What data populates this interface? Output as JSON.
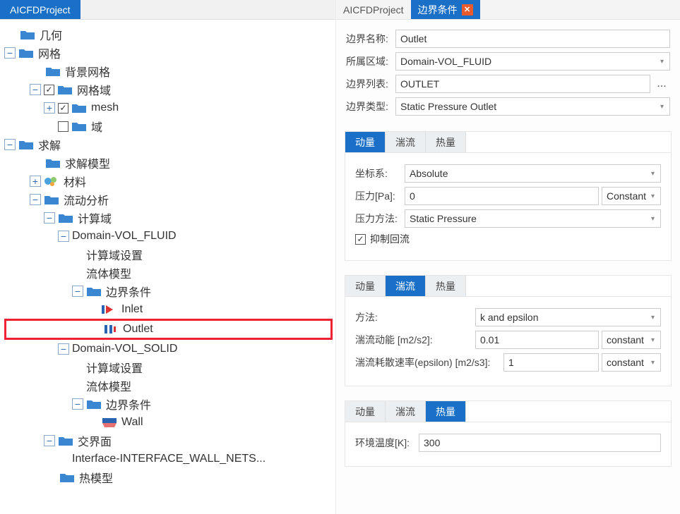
{
  "left": {
    "tab_title": "AICFDProject",
    "tree": {
      "geometry": "几何",
      "mesh_root": "网格",
      "bg_mesh": "背景网格",
      "mesh_domain": "网格域",
      "mesh_item": "mesh",
      "domain_item": "域",
      "solve": "求解",
      "solve_model": "求解模型",
      "materials": "材料",
      "flow_analysis": "流动分析",
      "comp_domain": "计算域",
      "domain_fluid": "Domain-VOL_FLUID",
      "domain_settings": "计算域设置",
      "fluid_model": "流体模型",
      "bc": "边界条件",
      "inlet": "Inlet",
      "outlet": "Outlet",
      "domain_solid": "Domain-VOL_SOLID",
      "wall": "Wall",
      "interfaces": "交界面",
      "interface_item": "Interface-INTERFACE_WALL_NETS...",
      "thermal_model": "热模型"
    }
  },
  "right": {
    "tab_project": "AICFDProject",
    "tab_bc": "边界条件",
    "labels": {
      "bc_name": "边界名称:",
      "region": "所属区域:",
      "bc_list": "边界列表:",
      "bc_type": "边界类型:",
      "coord": "坐标系:",
      "pressure": "压力[Pa]:",
      "pressure_method": "压力方法:",
      "suppress_backflow": "抑制回流",
      "method": "方法:",
      "tke": "湍流动能 [m2/s2]:",
      "eps": "湍流耗散速率(epsilon) [m2/s3]:",
      "env_temp": "环境温度[K]:"
    },
    "values": {
      "bc_name": "Outlet",
      "region": "Domain-VOL_FLUID",
      "bc_list": "OUTLET",
      "bc_type": "Static Pressure Outlet",
      "coord": "Absolute",
      "pressure": "0",
      "pressure_mode": "Constant",
      "pressure_method": "Static Pressure",
      "method": "k and epsilon",
      "tke": "0.01",
      "tke_mode": "constant",
      "eps": "1",
      "eps_mode": "constant",
      "env_temp": "300"
    },
    "subtabs": {
      "momentum": "动量",
      "turbulence": "湍流",
      "heat": "热量"
    }
  }
}
